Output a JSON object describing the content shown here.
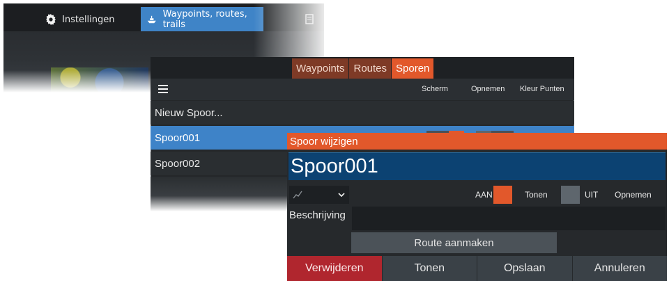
{
  "topbar": {
    "settings_label": "Instellingen",
    "waypoints_label": "Waypoints, routes, trails",
    "active_color": "#3f84c7",
    "icons": [
      "gear-icon",
      "boat-icon",
      "map-icon"
    ]
  },
  "tracks_panel": {
    "tabs": [
      {
        "label": "Waypoints",
        "active": false
      },
      {
        "label": "Routes",
        "active": false
      },
      {
        "label": "Sporen",
        "active": true
      }
    ],
    "columns": {
      "screen": "Scherm",
      "record": "Opnemen",
      "color_points": "Kleur Punten"
    },
    "new_track": "Nieuw Spoor...",
    "rows": [
      {
        "name": "Spoor001",
        "selected": true
      },
      {
        "name": "Spoor002",
        "selected": false
      }
    ],
    "accent_color": "#e2582b",
    "selected_color": "#3e83c8"
  },
  "edit_dialog": {
    "title": "Spoor wijzigen",
    "name_value": "Spoor001",
    "show_toggle": {
      "state_label": "AAN",
      "label": "Tonen",
      "on": true
    },
    "record_toggle": {
      "state_label": "UIT",
      "label": "Opnemen",
      "on": false
    },
    "description_label": "Beschrijving",
    "description_value": "",
    "create_route_label": "Route aanmaken",
    "footer": {
      "delete": "Verwijderen",
      "show": "Tonen",
      "save": "Opslaan",
      "cancel": "Annuleren"
    },
    "header_color": "#e2582b",
    "name_bg_color": "#0c4272",
    "delete_color": "#b0262e"
  }
}
